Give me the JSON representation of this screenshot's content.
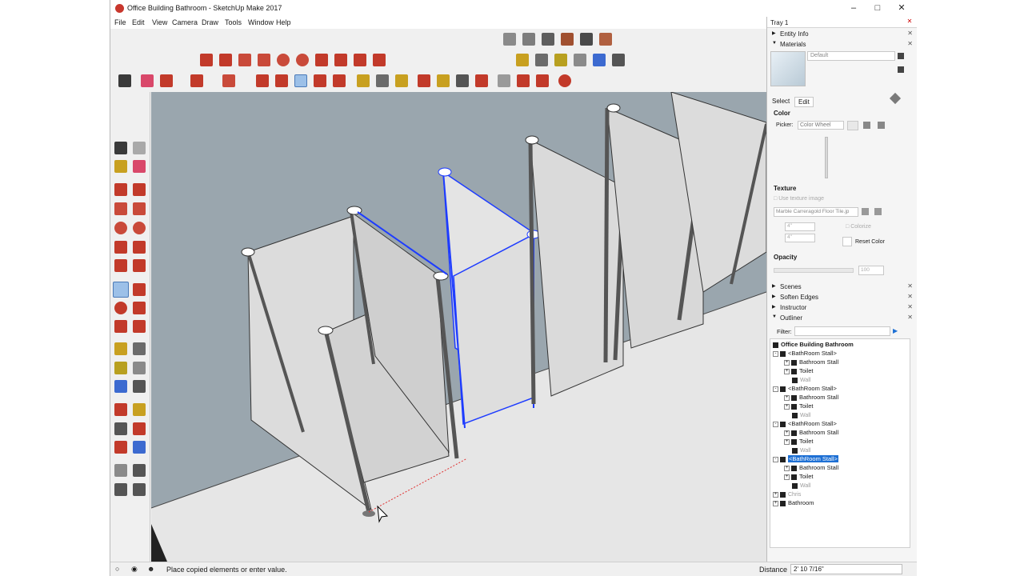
{
  "window": {
    "title": "Office Building Bathroom - SketchUp Make 2017"
  },
  "menu": [
    "File",
    "Edit",
    "View",
    "Camera",
    "Draw",
    "Tools",
    "Window",
    "Help"
  ],
  "status": {
    "message": "Place copied elements or enter value.",
    "distance_label": "Distance",
    "distance_value": "2' 10 7/16\""
  },
  "tray": {
    "title": "Tray 1",
    "entity_info": "Entity Info",
    "materials": {
      "title": "Materials",
      "material_name": "Default",
      "tabs": [
        "Select",
        "Edit"
      ],
      "color_label": "Color",
      "picker_label": "Picker:",
      "picker_value": "Color Wheel",
      "texture_label": "Texture",
      "use_texture_image": "Use texture image",
      "texture_file": "Marble Carreragold Floor Tile.jp",
      "width_value": "4\"",
      "height_value": "4\"",
      "colorize": "Colorize",
      "reset_color": "Reset Color",
      "opacity_label": "Opacity",
      "opacity_value": "100"
    },
    "collapsed_panels": [
      "Scenes",
      "Soften Edges",
      "Instructor"
    ],
    "outliner": {
      "title": "Outliner",
      "filter_label": "Filter:",
      "root": "Office Building Bathroom",
      "groups": [
        {
          "name": "<BathRoom Stall>",
          "children": [
            "Bathroom Stall",
            "Toilet",
            "Wall"
          ]
        },
        {
          "name": "<BathRoom Stall>",
          "children": [
            "Bathroom Stall",
            "Toilet",
            "Wall"
          ]
        },
        {
          "name": "<BathRoom Stall>",
          "children": [
            "Bathroom Stall",
            "Toilet",
            "Wall"
          ]
        },
        {
          "name": "<BathRoom Stall>",
          "children": [
            "Bathroom Stall",
            "Toilet",
            "Wall"
          ],
          "selected": true
        }
      ],
      "extra": [
        "Chris",
        "Bathroom"
      ]
    }
  },
  "colors": {
    "selection": "#1e3cff",
    "viewport_bg": "#9aa6ae",
    "ground": "#e6e6e6",
    "panel": "#d9d9d9"
  }
}
